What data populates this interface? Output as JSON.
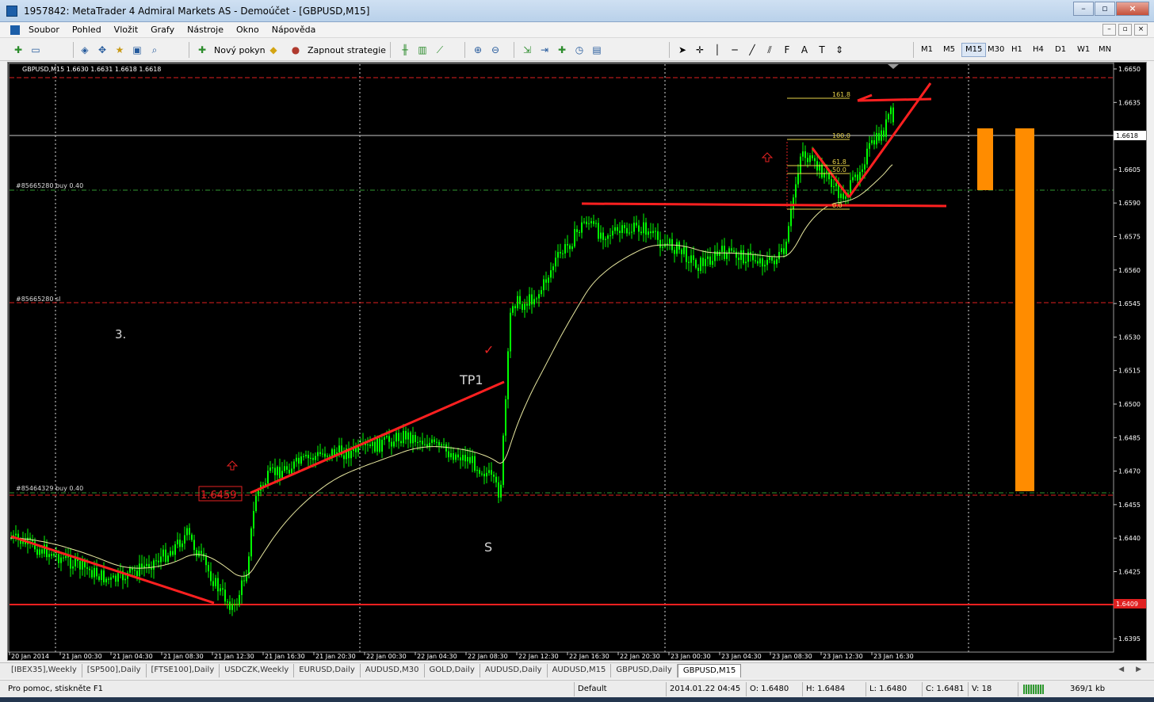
{
  "window": {
    "title": "1957842: MetaTrader 4 Admiral Markets AS - Demoúčet - [GBPUSD,M15]",
    "buttons": [
      "–",
      "▫",
      "×"
    ]
  },
  "menu": {
    "items": [
      "Soubor",
      "Pohled",
      "Vložit",
      "Grafy",
      "Nástroje",
      "Okno",
      "Nápověda"
    ],
    "child_buttons": [
      "–",
      "▫",
      "×"
    ]
  },
  "toolbar": {
    "new_order_label": "Nový pokyn",
    "strategy_label": "Zapnout strategie",
    "timeframes": [
      "M1",
      "M5",
      "M15",
      "M30",
      "H1",
      "H4",
      "D1",
      "W1",
      "MN"
    ],
    "active_timeframe": "M15"
  },
  "chart": {
    "header": "GBPUSD,M15  1.6630 1.6631 1.6618 1.6618",
    "current_price": "1.6618",
    "support_price": "1.6409",
    "price_ticks": [
      "1.6650",
      "1.6635",
      "1.6620",
      "1.6605",
      "1.6590",
      "1.6575",
      "1.6560",
      "1.6545",
      "1.6530",
      "1.6515",
      "1.6500",
      "1.6485",
      "1.6470",
      "1.6455",
      "1.6440",
      "1.6425",
      "1.6395"
    ],
    "time_ticks": [
      "20 Jan 2014",
      "21 Jan 00:30",
      "21 Jan 04:30",
      "21 Jan 08:30",
      "21 Jan 12:30",
      "21 Jan 16:30",
      "21 Jan 20:30",
      "22 Jan 00:30",
      "22 Jan 04:30",
      "22 Jan 08:30",
      "22 Jan 12:30",
      "22 Jan 16:30",
      "22 Jan 20:30",
      "23 Jan 00:30",
      "23 Jan 04:30",
      "23 Jan 08:30",
      "23 Jan 12:30",
      "23 Jan 16:30"
    ],
    "orders": {
      "buy_top": "#85665280 buy 0.40",
      "sl": "#85665280 sl",
      "buy_bottom": "#85464329 buy 0.40"
    },
    "annotations": {
      "number": "3.",
      "tp": "TP1",
      "s": "S",
      "entry_price": "1.6459",
      "check": "✓"
    },
    "fib_levels": [
      "161.8",
      "100.0",
      "61.8",
      "50.0",
      "0.0"
    ],
    "colors": {
      "background": "#000000",
      "candles": "#00ff00",
      "moving_average": "#e8e8a0",
      "drawing": "#ff2020",
      "volume_bar": "#ff8c00",
      "grid": "#ffffff"
    }
  },
  "tabs": {
    "items": [
      "[IBEX35],Weekly",
      "[SP500],Daily",
      "[FTSE100],Daily",
      "USDCZK,Weekly",
      "EURUSD,Daily",
      "AUDUSD,M30",
      "GOLD,Daily",
      "AUDUSD,Daily",
      "AUDUSD,M15",
      "GBPUSD,Daily",
      "GBPUSD,M15"
    ],
    "active": "GBPUSD,M15",
    "nav": "◀ ▶"
  },
  "status": {
    "help": "Pro pomoc, stiskněte F1",
    "profile": "Default",
    "datetime": "2014.01.22 04:45",
    "open": "O: 1.6480",
    "high": "H: 1.6484",
    "low": "L: 1.6480",
    "close": "C: 1.6481",
    "volume": "V: 18",
    "traffic": "369/1 kb"
  }
}
